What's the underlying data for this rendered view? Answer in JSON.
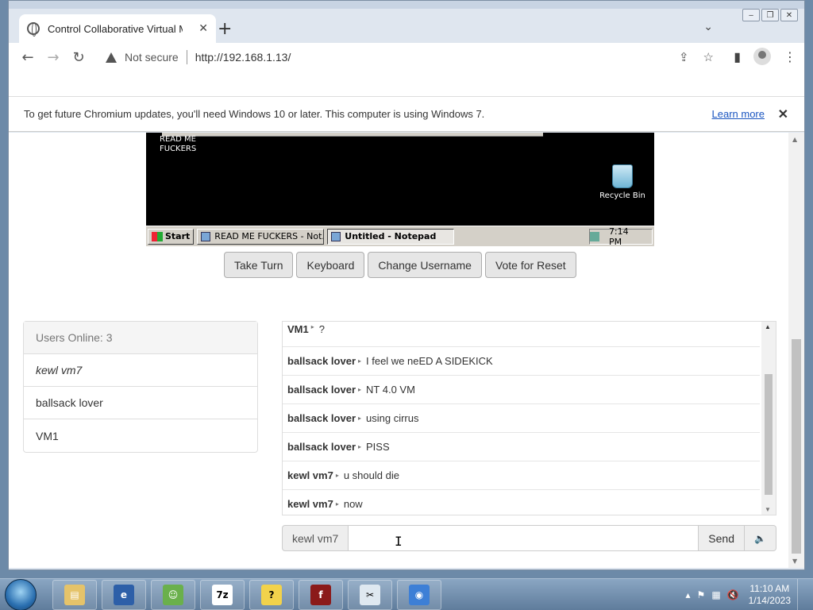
{
  "browser": {
    "tab_title": "Control Collaborative Virtual Ma",
    "new_tab_symbol": "+",
    "tab_close_symbol": "✕",
    "not_secure_label": "Not secure",
    "url": "http://192.168.1.13/",
    "window_controls": [
      "‒",
      "❐",
      "✕"
    ]
  },
  "infobar": {
    "message": "To get future Chromium updates, you'll need Windows 10 or later. This computer is using Windows 7.",
    "learn_more": "Learn more",
    "close_symbol": "✕"
  },
  "vm": {
    "desktop_text": "READ ME\nFUCKERS",
    "recycle_label": "Recycle Bin",
    "start_label": "Start",
    "tasks": [
      "READ ME FUCKERS - Not...",
      "Untitled - Notepad"
    ],
    "active_task_index": 1,
    "clock": "7:14 PM"
  },
  "controls": {
    "take_turn": "Take Turn",
    "keyboard": "Keyboard",
    "change_username": "Change Username",
    "vote_reset": "Vote for Reset"
  },
  "users": {
    "header": "Users Online: 3",
    "list": [
      {
        "name": "kewl vm7",
        "is_self": true
      },
      {
        "name": "ballsack lover",
        "is_self": false
      },
      {
        "name": "VM1",
        "is_self": false
      }
    ]
  },
  "chat": {
    "messages": [
      {
        "user": "VM1",
        "text": "?"
      },
      {
        "user": "ballsack lover",
        "text": "I feel we neED A SIDEKICK"
      },
      {
        "user": "ballsack lover",
        "text": "NT 4.0 VM"
      },
      {
        "user": "ballsack lover",
        "text": "using cirrus"
      },
      {
        "user": "ballsack lover",
        "text": "PISS"
      },
      {
        "user": "kewl vm7",
        "text": "u should die"
      },
      {
        "user": "kewl vm7",
        "text": "now"
      }
    ],
    "username_addon": "kewl vm7",
    "input_value": "",
    "send_label": "Send",
    "sound_symbol": "🔈"
  },
  "taskbar": {
    "apps": [
      {
        "name": "explorer",
        "symbol": "▤",
        "color": "#e5c36a"
      },
      {
        "name": "ie-style",
        "symbol": "e",
        "color": "#2d5fa8"
      },
      {
        "name": "people",
        "symbol": "☺",
        "color": "#6ab04c"
      },
      {
        "name": "7zip",
        "symbol": "7z",
        "color": "#ffffff"
      },
      {
        "name": "help",
        "symbol": "?",
        "color": "#f2d24b"
      },
      {
        "name": "flash",
        "symbol": "f",
        "color": "#8b1a1a"
      },
      {
        "name": "snipping",
        "symbol": "✂",
        "color": "#dfe8f0"
      },
      {
        "name": "chromium",
        "symbol": "◉",
        "color": "#3d7fd6"
      }
    ],
    "time": "11:10 AM",
    "date": "1/14/2023"
  }
}
